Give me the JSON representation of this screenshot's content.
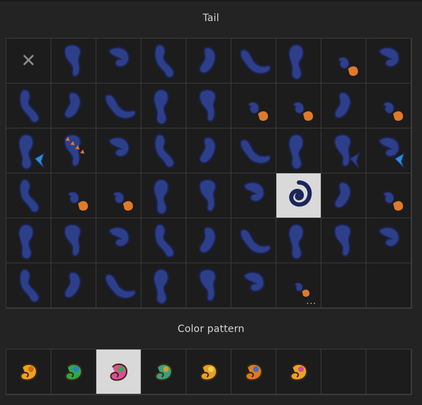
{
  "tail_section": {
    "title": "Tail",
    "none_glyph": "✕",
    "more_glyph": "...",
    "selected_index": 33,
    "items": [
      {
        "icon": "none-icon"
      },
      {
        "icon": "tail-icon"
      },
      {
        "icon": "tail-icon"
      },
      {
        "icon": "tail-icon"
      },
      {
        "icon": "tail-icon"
      },
      {
        "icon": "tail-icon"
      },
      {
        "icon": "tail-icon"
      },
      {
        "icon": "tail-tuft-icon"
      },
      {
        "icon": "tail-icon"
      },
      {
        "icon": "tail-icon"
      },
      {
        "icon": "tail-icon"
      },
      {
        "icon": "tail-icon"
      },
      {
        "icon": "tail-icon"
      },
      {
        "icon": "tail-icon"
      },
      {
        "icon": "tail-tuft-icon"
      },
      {
        "icon": "tail-tuft-icon"
      },
      {
        "icon": "tail-icon"
      },
      {
        "icon": "tail-tuft-icon"
      },
      {
        "icon": "tail-fin-icon"
      },
      {
        "icon": "tail-spiked-icon"
      },
      {
        "icon": "tail-icon"
      },
      {
        "icon": "tail-icon"
      },
      {
        "icon": "tail-icon"
      },
      {
        "icon": "tail-icon"
      },
      {
        "icon": "tail-icon"
      },
      {
        "icon": "tail-fin-icon"
      },
      {
        "icon": "tail-fin-icon"
      },
      {
        "icon": "tail-icon"
      },
      {
        "icon": "tail-tuft-icon"
      },
      {
        "icon": "tail-tuft-icon"
      },
      {
        "icon": "tail-icon"
      },
      {
        "icon": "tail-icon"
      },
      {
        "icon": "tail-icon"
      },
      {
        "icon": "tail-curl-icon"
      },
      {
        "icon": "tail-icon"
      },
      {
        "icon": "tail-tuft-icon"
      },
      {
        "icon": "tail-icon"
      },
      {
        "icon": "tail-icon"
      },
      {
        "icon": "tail-icon"
      },
      {
        "icon": "tail-icon"
      },
      {
        "icon": "tail-icon"
      },
      {
        "icon": "tail-icon"
      },
      {
        "icon": "tail-icon"
      },
      {
        "icon": "tail-icon"
      },
      {
        "icon": "tail-icon"
      },
      {
        "icon": "tail-icon"
      },
      {
        "icon": "tail-icon"
      },
      {
        "icon": "tail-icon"
      },
      {
        "icon": "tail-icon"
      },
      {
        "icon": "tail-icon"
      },
      {
        "icon": "tail-icon"
      },
      {
        "icon": "tail-more-icon"
      },
      {
        "icon": "empty"
      },
      {
        "icon": "empty"
      }
    ]
  },
  "color_section": {
    "title": "Color pattern",
    "selected_index": 2,
    "items": [
      {
        "icon": "pattern-icon",
        "colors": [
          "#f0a020",
          "#c87010"
        ]
      },
      {
        "icon": "pattern-icon",
        "colors": [
          "#2ea84a",
          "#2a7fd0"
        ]
      },
      {
        "icon": "pattern-icon",
        "colors": [
          "#e04c9c",
          "#2ab04c"
        ]
      },
      {
        "icon": "pattern-icon",
        "colors": [
          "#3aa07a",
          "#c8a030"
        ]
      },
      {
        "icon": "pattern-icon",
        "colors": [
          "#e8a020",
          "#f0d050"
        ]
      },
      {
        "icon": "pattern-icon",
        "colors": [
          "#e07a20",
          "#3a70c0"
        ]
      },
      {
        "icon": "pattern-icon",
        "colors": [
          "#f0a020",
          "#d04c9c"
        ]
      },
      {
        "icon": "empty"
      },
      {
        "icon": "empty"
      }
    ]
  },
  "colors": {
    "tail_blue": "#2e3f8a",
    "tail_outline": "#1b2558",
    "accent_orange": "#e07a2a",
    "accent_blue": "#2a8fd6",
    "selected_bg": "#d9d9d9"
  }
}
